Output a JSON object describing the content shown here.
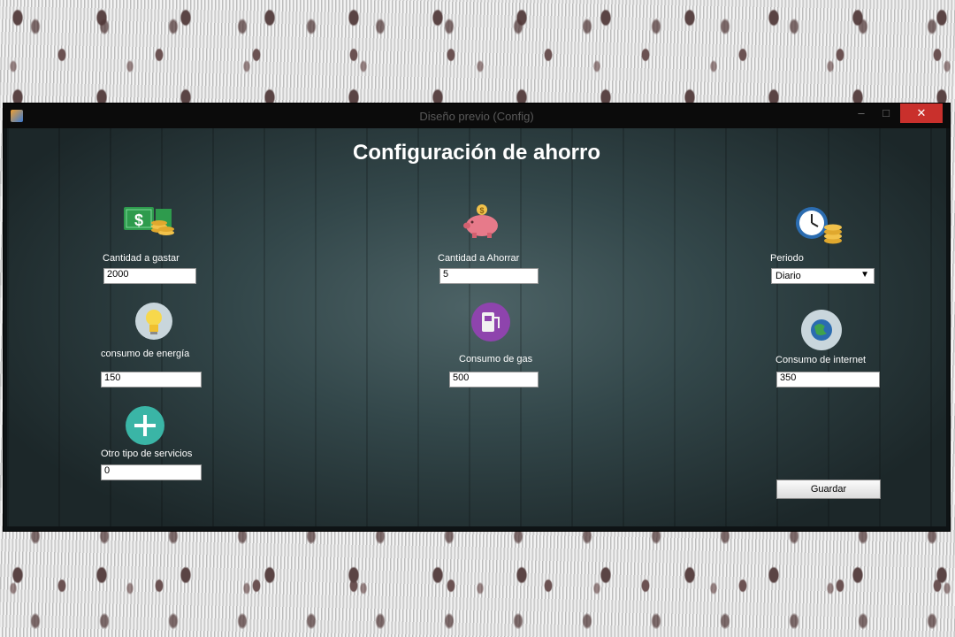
{
  "window": {
    "title": "Diseño previo (Config)",
    "minimize": "–",
    "maximize": "□",
    "close": "✕"
  },
  "page": {
    "heading": "Configuración de ahorro"
  },
  "fields": {
    "gastar": {
      "label": "Cantidad a gastar",
      "value": "2000",
      "icon": "money-coins-icon"
    },
    "ahorrar": {
      "label": "Cantidad a Ahorrar",
      "value": "5",
      "icon": "piggy-bank-icon"
    },
    "periodo": {
      "label": "Periodo",
      "value": "Diario",
      "icon": "clock-coins-icon"
    },
    "energia": {
      "label": "consumo de energía",
      "value": "150",
      "icon": "lightbulb-icon"
    },
    "gas": {
      "label": "Consumo de gas",
      "value": "500",
      "icon": "gas-pump-icon"
    },
    "internet": {
      "label": "Consumo de internet",
      "value": "350",
      "icon": "globe-icon"
    },
    "otro": {
      "label": "Otro tipo de servicios",
      "value": "0",
      "icon": "plus-icon"
    }
  },
  "actions": {
    "save_label": "Guardar"
  },
  "colors": {
    "close_button": "#c9302c",
    "money_green": "#2e9b4d",
    "piggy_pink": "#e77a8a",
    "gas_purple": "#8e44ad",
    "plus_teal": "#3ab5a6",
    "globe_blue": "#2b6cb0"
  }
}
